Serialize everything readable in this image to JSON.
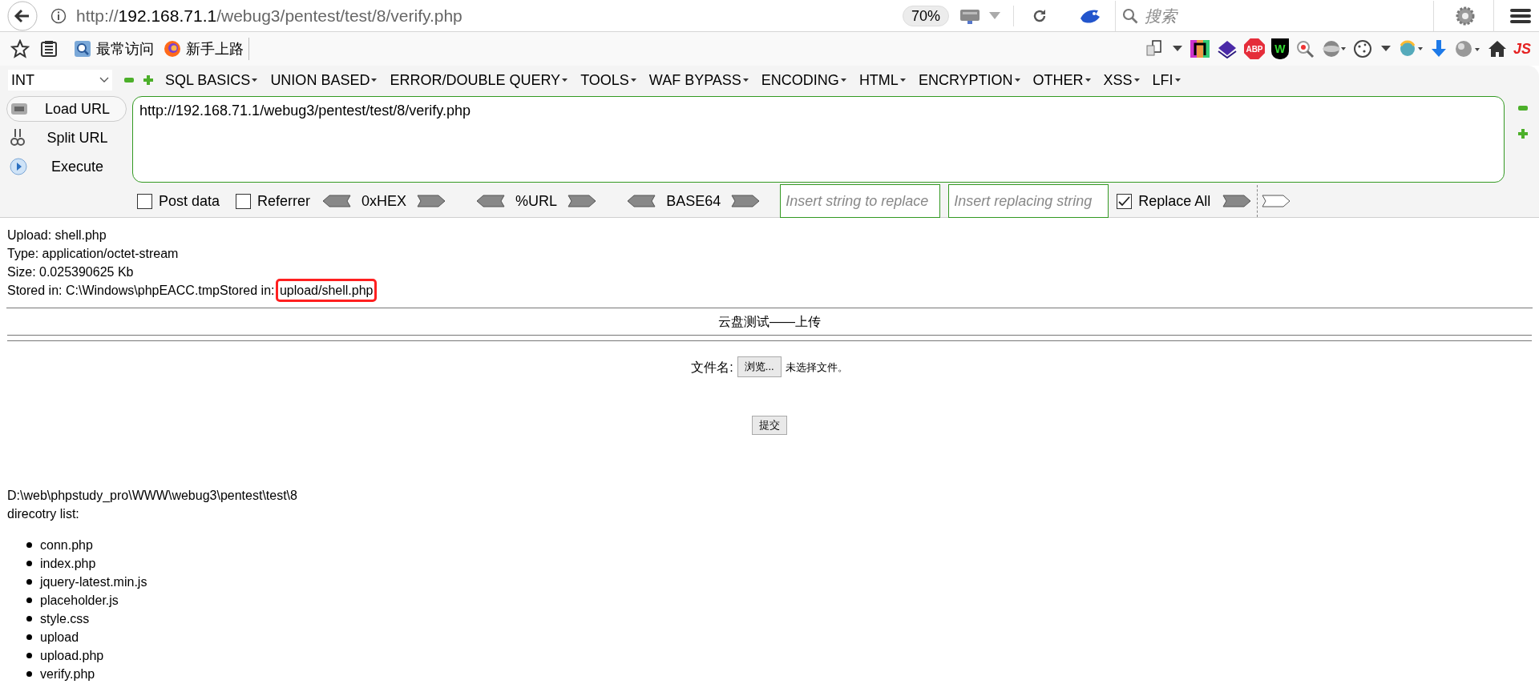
{
  "browser": {
    "url_scheme": "http://",
    "url_host": "192.168.71.1",
    "url_path": "/webug3/pentest/test/8/verify.php",
    "zoom": "70%",
    "search_placeholder": "搜索"
  },
  "bookmarks": [
    {
      "label": "最常访问"
    },
    {
      "label": "新手上路"
    }
  ],
  "extension_badges": [
    "ABP",
    "W",
    "JS"
  ],
  "hackbar": {
    "select": "INT",
    "menus": [
      "SQL BASICS",
      "UNION BASED",
      "ERROR/DOUBLE QUERY",
      "TOOLS",
      "WAF BYPASS",
      "ENCODING",
      "HTML",
      "ENCRYPTION",
      "OTHER",
      "XSS",
      "LFI"
    ],
    "actions": [
      {
        "label": "Load URL",
        "kind": "load"
      },
      {
        "label": "Split URL",
        "kind": "split"
      },
      {
        "label": "Execute",
        "kind": "execute"
      }
    ],
    "url_value": "http://192.168.71.1/webug3/pentest/test/8/verify.php",
    "options": [
      {
        "label": "Post data",
        "checked": false
      },
      {
        "label": "Referrer",
        "checked": false
      }
    ],
    "encoders": [
      "0xHEX",
      "%URL",
      "BASE64"
    ],
    "replace_fields": [
      {
        "placeholder": "Insert string to replace"
      },
      {
        "placeholder": "Insert replacing string"
      }
    ],
    "replace_all": {
      "label": "Replace All",
      "checked": true
    }
  },
  "result": {
    "lines": [
      "Upload: shell.php",
      "Type: application/octet-stream",
      "Size: 0.025390625 Kb"
    ],
    "stored_prefix": "Stored in: C:\\Windows\\phpEACC.tmpStored in: ",
    "stored_path": "upload/shell.php",
    "stored_path_highlighted": true
  },
  "form": {
    "heading": "云盘测试——上传",
    "file_label": "文件名:",
    "browse_button": "浏览...",
    "no_file": "未选择文件。",
    "submit_button": "提交"
  },
  "listing": {
    "path": "D:\\web\\phpstudy_pro\\WWW\\webug3\\pentest\\test\\8",
    "title": "direcotry list:",
    "files": [
      "conn.php",
      "index.php",
      "jquery-latest.min.js",
      "placeholder.js",
      "style.css",
      "upload",
      "upload.php",
      "verify.php"
    ]
  }
}
